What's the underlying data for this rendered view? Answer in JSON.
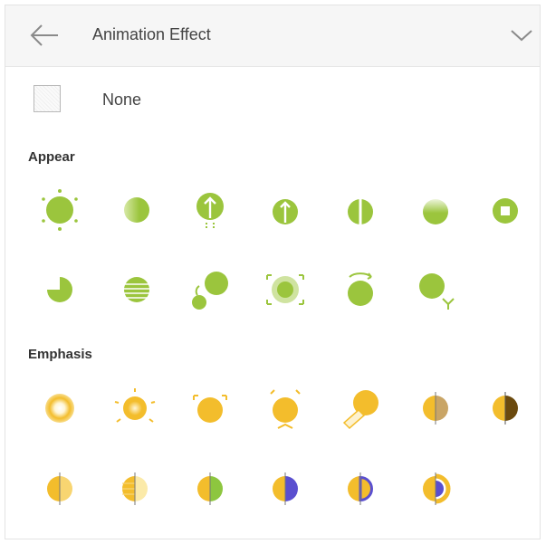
{
  "header": {
    "title": "Animation Effect",
    "back_icon": "arrow-left-icon",
    "collapse_icon": "chevron-down-icon"
  },
  "none_option": {
    "label": "None"
  },
  "sections": [
    {
      "title": "Appear",
      "accent": "#9bc53d",
      "effects": [
        "appear-burst-icon",
        "appear-wipe-icon",
        "appear-rise-arrow-icon",
        "appear-fly-in-icon",
        "appear-split-icon",
        "appear-fade-icon",
        "appear-box-icon",
        "appear-wheel-icon",
        "appear-blinds-icon",
        "appear-bounce-icon",
        "appear-zoom-icon",
        "appear-spin-icon",
        "appear-swivel-icon"
      ]
    },
    {
      "title": "Emphasis",
      "accent": "#f3bd2c",
      "second_accents": [
        "#8dc63f",
        "#5a4fcf",
        "#6b4a0e"
      ],
      "effects": [
        "emphasis-pulse-icon",
        "emphasis-flash-icon",
        "emphasis-grow-icon",
        "emphasis-teeter-icon",
        "emphasis-spotlight-icon",
        "emphasis-darken-icon",
        "emphasis-desaturate-icon",
        "emphasis-transparency-icon",
        "emphasis-lighten-icon",
        "emphasis-color-green-icon",
        "emphasis-color-blue-icon",
        "emphasis-outline-blue-icon",
        "emphasis-half-blue-icon"
      ]
    }
  ]
}
